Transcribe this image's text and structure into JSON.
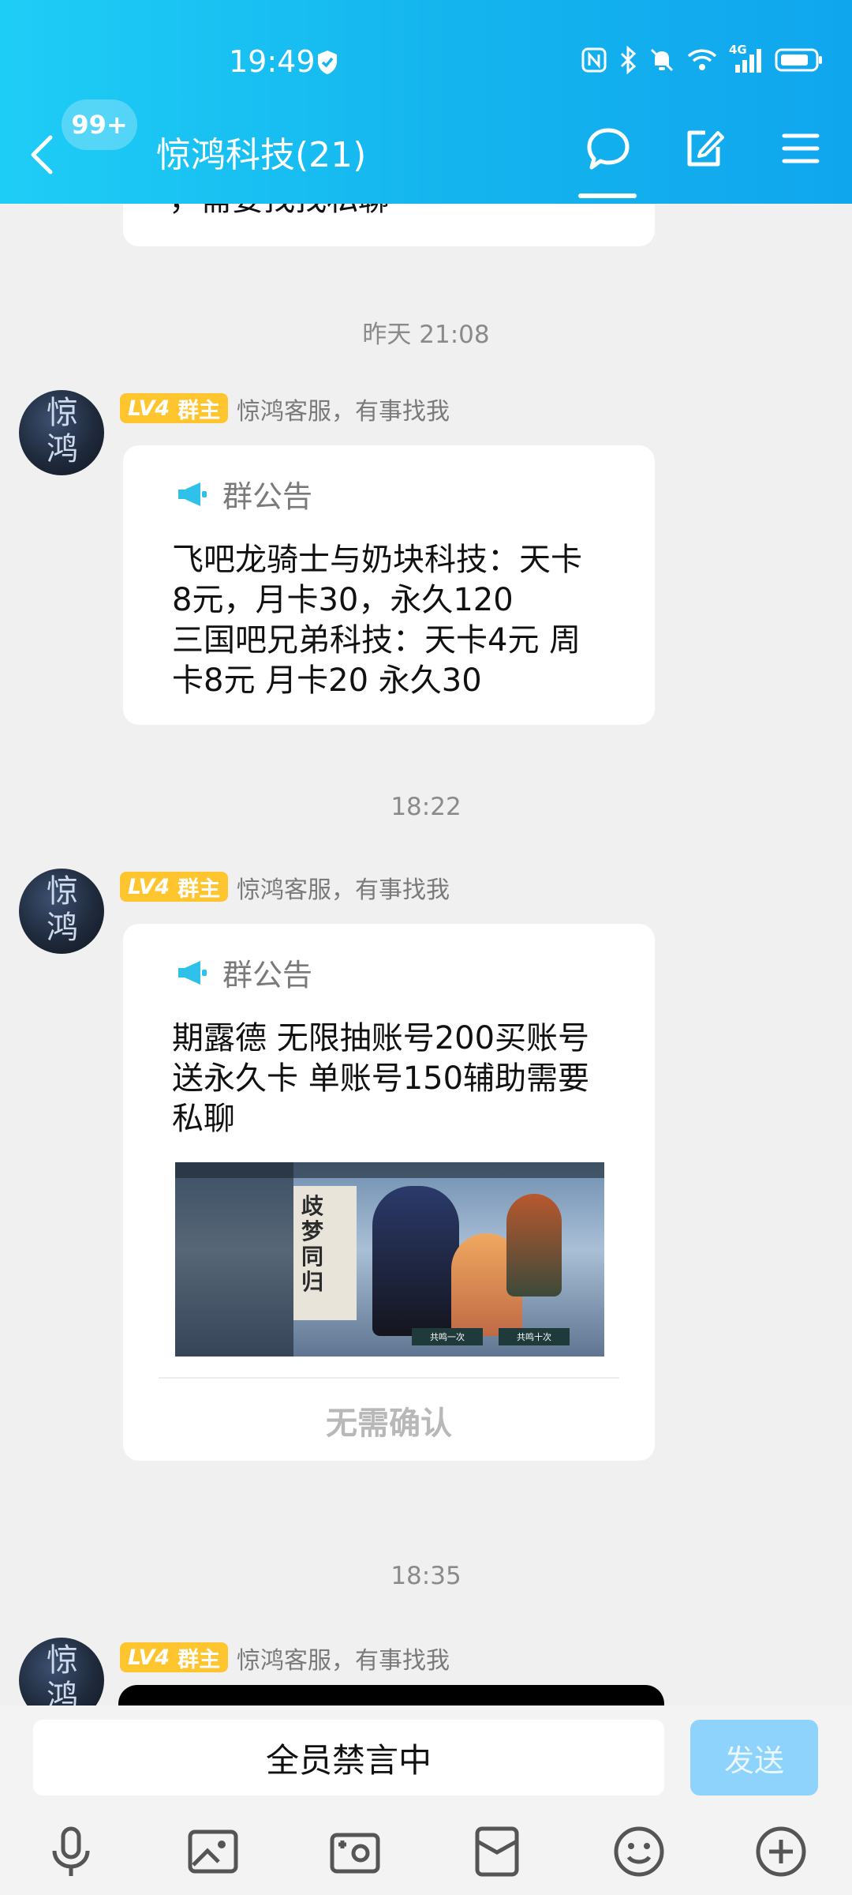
{
  "status_bar": {
    "time": "19:49",
    "network": "4G"
  },
  "header": {
    "unread_count": "99+",
    "title": "惊鸿科技(21)"
  },
  "messages": {
    "top_fragment": "，需要找找私聊",
    "sep1": "昨天 21:08",
    "msg1": {
      "level": "LV4",
      "role": "群主",
      "sender": "惊鸿客服，有事找我",
      "notice_label": "群公告",
      "body": "飞吧龙骑士与奶块科技：天卡\n8元，月卡30，永久120\n三国吧兄弟科技：天卡4元 周\n卡8元 月卡20 永久30"
    },
    "sep2": "18:22",
    "msg2": {
      "level": "LV4",
      "role": "群主",
      "sender": "惊鸿客服，有事找我",
      "notice_label": "群公告",
      "body": "期露德 无限抽账号200买账号\n送永久卡 单账号150辅助需要\n私聊",
      "image_text": {
        "title": "歧梦同归",
        "btn1": "共鸣一次",
        "btn2": "共鸣十次"
      },
      "confirm_label": "无需确认"
    },
    "sep3": "18:35",
    "msg3": {
      "level": "LV4",
      "role": "群主",
      "sender": "惊鸿客服，有事找我"
    }
  },
  "avatar_text": "惊鸿",
  "input": {
    "mute_text": "全员禁言中",
    "send_label": "发送"
  },
  "colors": {
    "header": "#14b4ee",
    "badge": "#ffc52e",
    "send": "#8ed3fb",
    "notice_icon": "#2ec1ea"
  }
}
